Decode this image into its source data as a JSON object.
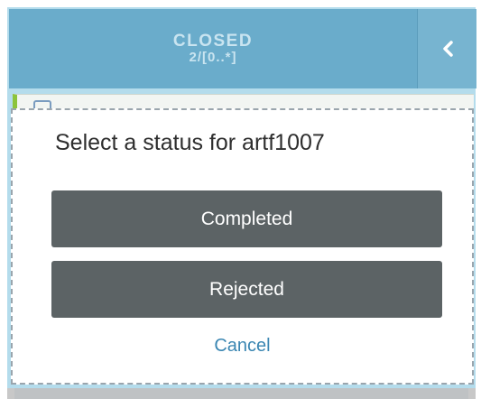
{
  "column": {
    "status": "CLOSED",
    "wip_limit": "2/[0..*]",
    "collapse_icon": "chevron-left-icon",
    "header_color": "#6aaccb",
    "card_accent": "#8cc43c"
  },
  "dialog": {
    "title": "Select a status for artf1007",
    "options": {
      "completed": "Completed",
      "rejected": "Rejected"
    },
    "cancel_label": "Cancel",
    "button_color": "#5c6365",
    "link_color": "#3a86b2"
  }
}
